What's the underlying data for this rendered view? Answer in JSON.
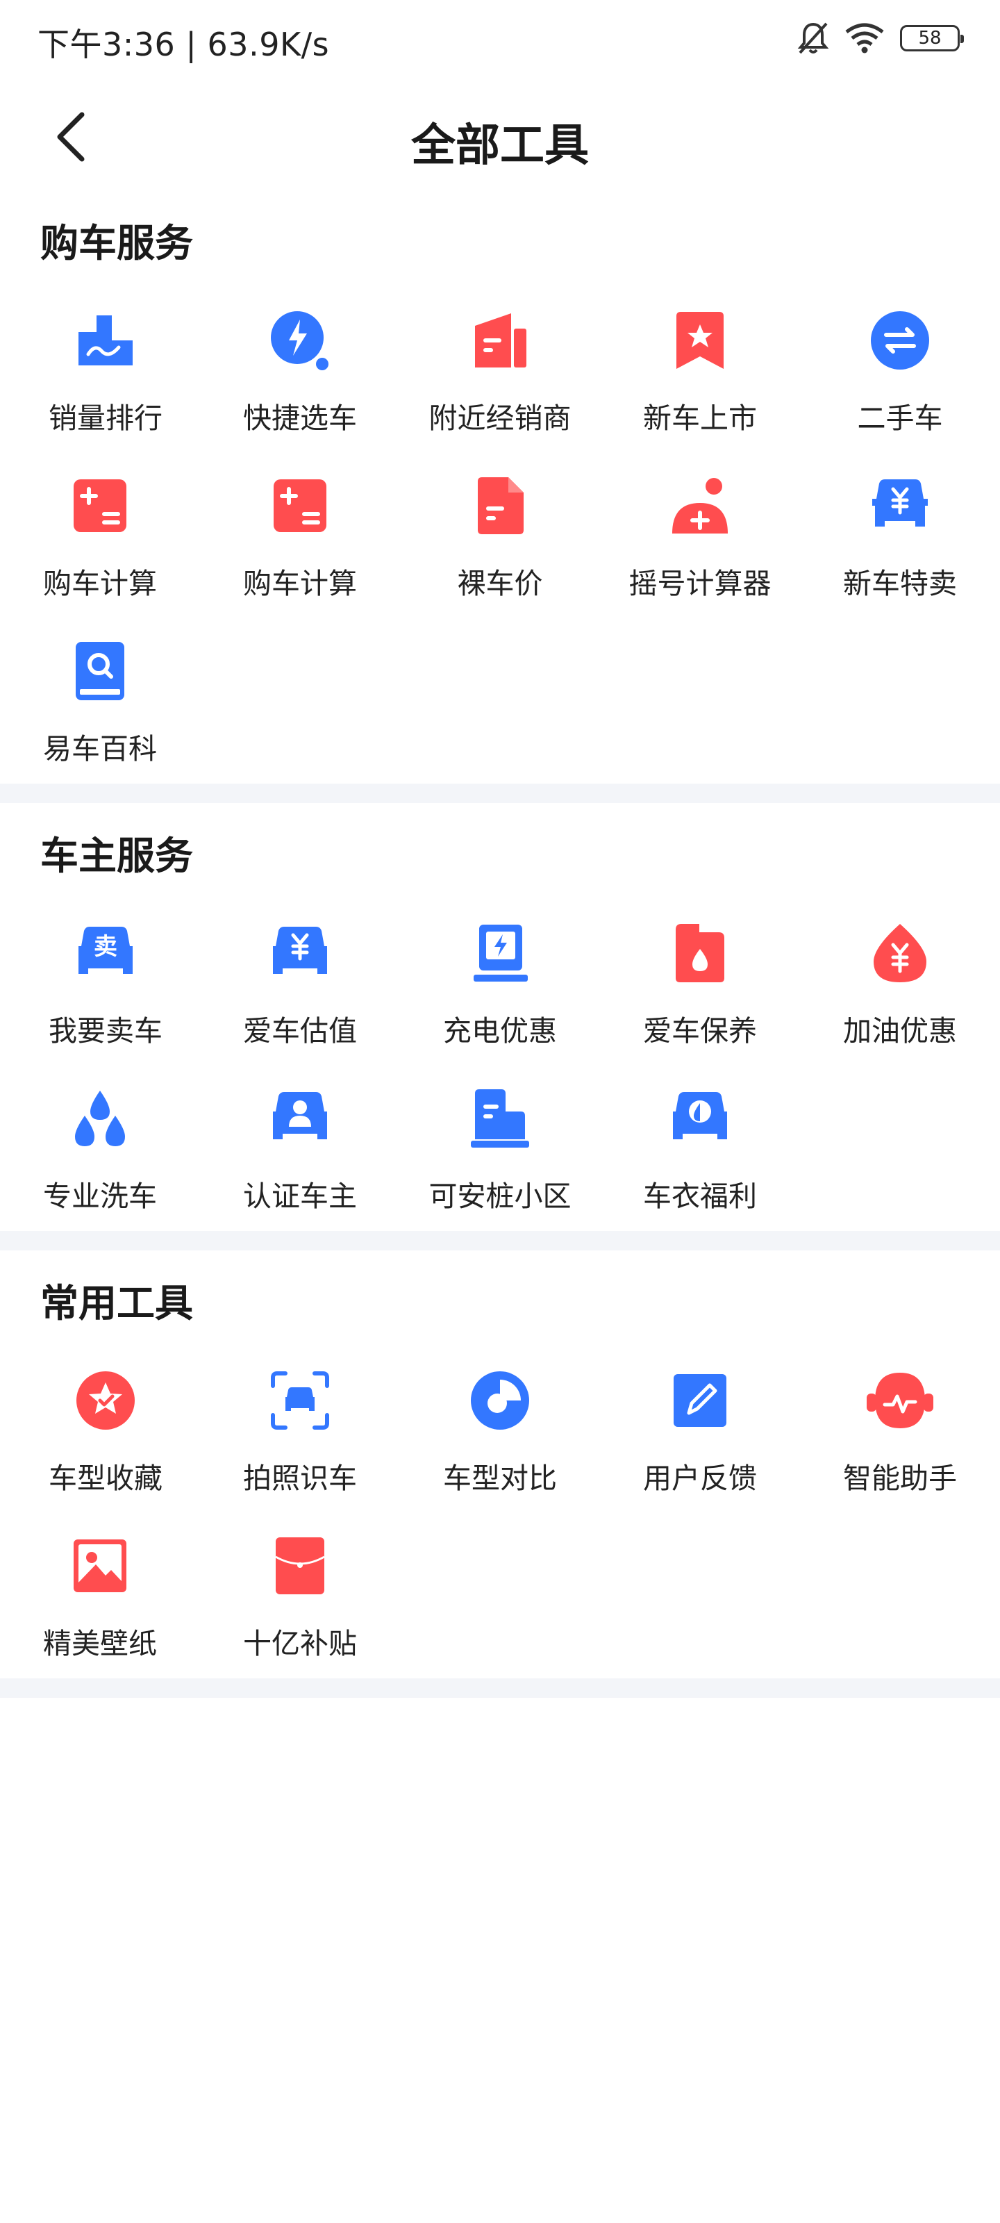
{
  "status_bar": {
    "time_speed": "下午3:36 | 63.9K/s",
    "battery": "58"
  },
  "header": {
    "title": "全部工具"
  },
  "colors": {
    "blue": "#3377ff",
    "red": "#ff4d4f",
    "divider": "#f3f5f9"
  },
  "sections": {
    "purchase": {
      "title": "购车服务",
      "items": [
        {
          "label": "销量排行",
          "icon": "sales-rank-icon"
        },
        {
          "label": "快捷选车",
          "icon": "quick-select-icon"
        },
        {
          "label": "附近经销商",
          "icon": "dealer-icon"
        },
        {
          "label": "新车上市",
          "icon": "new-car-icon"
        },
        {
          "label": "二手车",
          "icon": "used-car-icon"
        },
        {
          "label": "购车计算",
          "icon": "calculator-icon"
        },
        {
          "label": "购车计算",
          "icon": "calculator-icon"
        },
        {
          "label": "裸车价",
          "icon": "price-doc-icon"
        },
        {
          "label": "摇号计算器",
          "icon": "lottery-icon"
        },
        {
          "label": "新车特卖",
          "icon": "sale-car-icon"
        },
        {
          "label": "易车百科",
          "icon": "encyclopedia-icon"
        }
      ]
    },
    "owner": {
      "title": "车主服务",
      "items": [
        {
          "label": "我要卖车",
          "icon": "sell-car-icon"
        },
        {
          "label": "爱车估值",
          "icon": "valuation-icon"
        },
        {
          "label": "充电优惠",
          "icon": "charging-icon"
        },
        {
          "label": "爱车保养",
          "icon": "maintenance-icon"
        },
        {
          "label": "加油优惠",
          "icon": "fuel-icon"
        },
        {
          "label": "专业洗车",
          "icon": "car-wash-icon"
        },
        {
          "label": "认证车主",
          "icon": "certified-owner-icon"
        },
        {
          "label": "可安桩小区",
          "icon": "charger-community-icon"
        },
        {
          "label": "车衣福利",
          "icon": "car-cover-icon"
        }
      ]
    },
    "common": {
      "title": "常用工具",
      "items": [
        {
          "label": "车型收藏",
          "icon": "favorite-icon"
        },
        {
          "label": "拍照识车",
          "icon": "scan-car-icon"
        },
        {
          "label": "车型对比",
          "icon": "compare-icon"
        },
        {
          "label": "用户反馈",
          "icon": "feedback-icon"
        },
        {
          "label": "智能助手",
          "icon": "assistant-icon"
        },
        {
          "label": "精美壁纸",
          "icon": "wallpaper-icon"
        },
        {
          "label": "十亿补贴",
          "icon": "subsidy-icon"
        }
      ]
    }
  }
}
